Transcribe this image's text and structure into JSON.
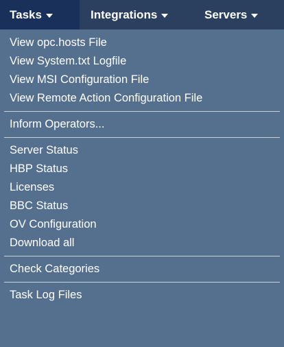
{
  "menubar": {
    "tabs": [
      {
        "label": "Tasks"
      },
      {
        "label": "Integrations"
      },
      {
        "label": "Servers"
      }
    ]
  },
  "dropdown": {
    "groups": [
      {
        "items": [
          {
            "label": "View opc.hosts File"
          },
          {
            "label": "View System.txt Logfile"
          },
          {
            "label": "View MSI Configuration File"
          },
          {
            "label": "View Remote Action Configuration File"
          }
        ]
      },
      {
        "items": [
          {
            "label": "Inform Operators..."
          }
        ]
      },
      {
        "items": [
          {
            "label": "Server Status"
          },
          {
            "label": "HBP Status"
          },
          {
            "label": "Licenses"
          },
          {
            "label": "BBC Status"
          },
          {
            "label": "OV Configuration"
          },
          {
            "label": "Download all"
          }
        ]
      },
      {
        "items": [
          {
            "label": "Check Categories"
          }
        ]
      },
      {
        "items": [
          {
            "label": "Task Log Files"
          }
        ]
      }
    ]
  },
  "colors": {
    "menubar_bg": "#2b3f5f",
    "active_tab_bg": "#18305a",
    "dropdown_bg": "#55708f",
    "separator": "#c9d3dd",
    "text": "#ffffff"
  }
}
